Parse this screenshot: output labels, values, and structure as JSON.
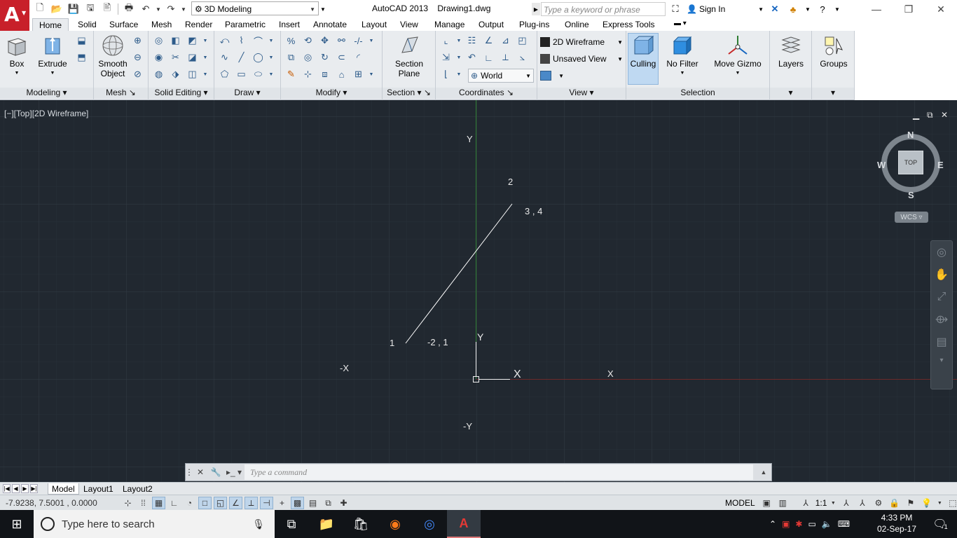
{
  "app": {
    "logo_letter": "A",
    "title": "AutoCAD 2013    Drawing1.dwg",
    "workspace": "3D Modeling",
    "search_placeholder": "Type a keyword or phrase",
    "sign_in": "Sign In"
  },
  "ribbon_tabs": [
    "Home",
    "Solid",
    "Surface",
    "Mesh",
    "Render",
    "Parametric",
    "Insert",
    "Annotate",
    "Layout",
    "View",
    "Manage",
    "Output",
    "Plug-ins",
    "Online",
    "Express Tools"
  ],
  "ribbon": {
    "modeling": {
      "title": "Modeling",
      "box": "Box",
      "extrude": "Extrude"
    },
    "mesh": {
      "title": "Mesh",
      "smooth_object_1": "Smooth",
      "smooth_object_2": "Object"
    },
    "solid_editing": {
      "title": "Solid Editing"
    },
    "draw": {
      "title": "Draw"
    },
    "modify": {
      "title": "Modify"
    },
    "section": {
      "title": "Section",
      "section_plane_1": "Section",
      "section_plane_2": "Plane"
    },
    "coordinates": {
      "title": "Coordinates",
      "ucs": "World"
    },
    "view": {
      "title": "View",
      "visual_style": "2D Wireframe",
      "named_view": "Unsaved View"
    },
    "selection": {
      "title": "Selection",
      "culling": "Culling",
      "no_filter": "No Filter",
      "move_gizmo": "Move Gizmo"
    },
    "layers": {
      "label": "Layers"
    },
    "groups": {
      "label": "Groups"
    }
  },
  "viewport": {
    "label": "[−][Top][2D Wireframe]",
    "ctrl_minimize": "▁",
    "ctrl_restore": "⧉",
    "ctrl_close": "✕",
    "canvas_labels": {
      "y_top": "Y",
      "pt2": "2",
      "pt34": "3 , 4",
      "pt1": "1",
      "pt_m21": "-2 , 1",
      "neg_x": "-X",
      "x_right": "X",
      "neg_y": "-Y",
      "ucs_y": "Y",
      "ucs_x": "X"
    },
    "viewcube": {
      "north": "N",
      "south": "S",
      "east": "E",
      "west": "W",
      "face": "TOP"
    },
    "wcs": "WCS ▿"
  },
  "command_line": {
    "placeholder": "Type a command"
  },
  "layout_tabs": [
    "Model",
    "Layout1",
    "Layout2"
  ],
  "statusbar": {
    "coordinates": "-7.9238, 7.5001 , 0.0000",
    "model": "MODEL",
    "annotation_scale": "1:1"
  },
  "taskbar": {
    "search_placeholder": "Type here to search",
    "time": "4:33 PM",
    "date": "02-Sep-17",
    "notifications": "1"
  },
  "colors": {
    "autocad_red": "#c8202a",
    "viewport_bg": "#212830",
    "ribbon_bg": "#e9ecef",
    "y_axis": "#2e7d32",
    "x_axis": "#8b2a2a"
  }
}
